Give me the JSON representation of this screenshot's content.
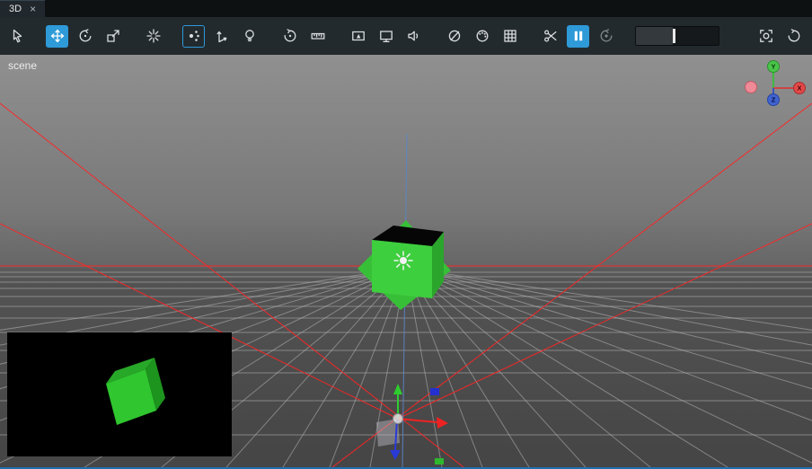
{
  "window": {
    "tab": {
      "title": "3D",
      "close_glyph": "×"
    }
  },
  "toolbar": {
    "buttons": [
      {
        "id": "select-tool",
        "icon": "pointer-icon",
        "active": false
      },
      {
        "id": "move-tool",
        "icon": "move-arrows-icon",
        "active": true
      },
      {
        "id": "rotate-tool",
        "icon": "rotate-icon",
        "active": false
      },
      {
        "id": "scale-tool",
        "icon": "scale-icon",
        "active": false
      },
      {
        "id": "center-pivot",
        "icon": "starburst-icon",
        "active": false
      },
      {
        "id": "vertex-snap-toggle",
        "icon": "dots-icon",
        "outlined": true
      },
      {
        "id": "axis-gizmo-toggle",
        "icon": "axis-arrow-icon",
        "active": false
      },
      {
        "id": "light-toggle",
        "icon": "lightbulb-icon",
        "active": false
      },
      {
        "id": "orbit-camera",
        "icon": "orbit-icon",
        "active": false
      },
      {
        "id": "ruler",
        "icon": "ruler-icon",
        "active": false
      },
      {
        "id": "camera-view",
        "icon": "camera-monitor-icon",
        "active": false
      },
      {
        "id": "monitor-view",
        "icon": "monitor-icon",
        "active": false
      },
      {
        "id": "audio-toggle",
        "icon": "speaker-icon",
        "active": false
      },
      {
        "id": "hide-objects",
        "icon": "eye-slash-icon",
        "active": false
      },
      {
        "id": "materials",
        "icon": "palette-icon",
        "active": false
      },
      {
        "id": "grid-toggle",
        "icon": "grid-icon",
        "active": false
      },
      {
        "id": "cut-tool",
        "icon": "scissors-icon",
        "active": false
      },
      {
        "id": "pause-playback",
        "icon": "pause-icon",
        "active": true
      },
      {
        "id": "loop-playback",
        "icon": "loop-icon",
        "disabled": true
      },
      {
        "id": "capture-screenshot",
        "icon": "capture-icon",
        "active": false
      },
      {
        "id": "reset-camera",
        "icon": "reset-icon",
        "active": false
      }
    ],
    "slider": {
      "value_pct": 45
    }
  },
  "viewport": {
    "scene_label": "scene",
    "axis_gizmo": {
      "x_label": "X",
      "y_label": "Y",
      "z_label": "Z"
    },
    "colors": {
      "accent_blue": "#2e9ad8",
      "frustum_red": "#ff2424",
      "cube_green": "#3ecf3e",
      "grid_gray": "#c0c0c0",
      "axis_y_green": "#49c549",
      "axis_x_red": "#e34848",
      "axis_z_blue": "#3f63cf"
    }
  }
}
